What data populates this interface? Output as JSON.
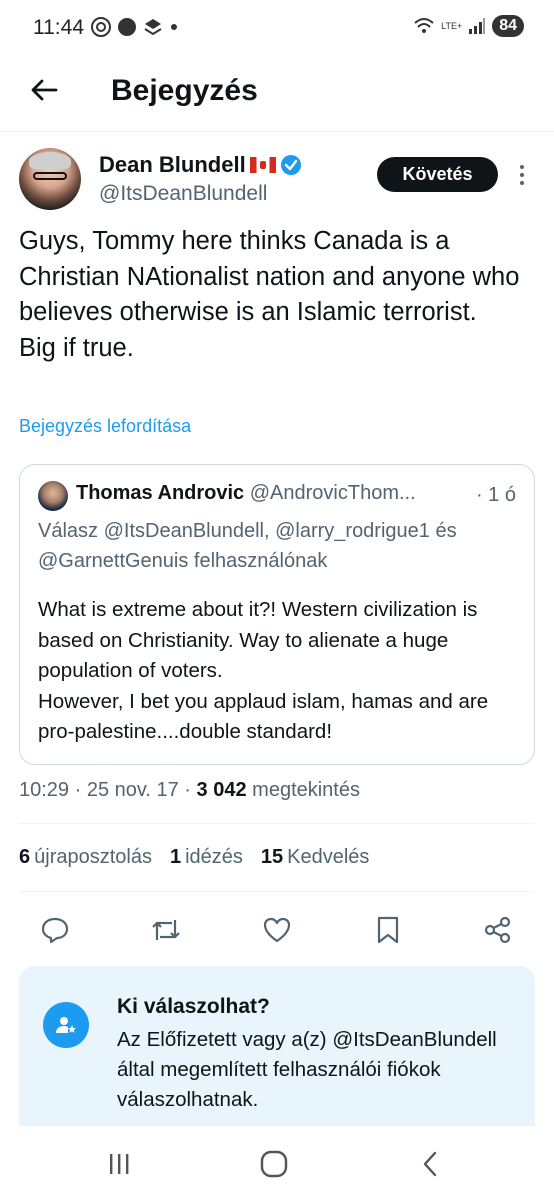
{
  "status_bar": {
    "time": "11:44",
    "network": "LTE+",
    "battery": "84"
  },
  "header": {
    "title": "Bejegyzés"
  },
  "post": {
    "author_name": "Dean Blundell",
    "author_handle": "@ItsDeanBlundell",
    "follow_label": "Követés",
    "text": "Guys, Tommy here thinks Canada is a Christian NAtionalist nation and anyone who believes otherwise is an Islamic terrorist.\nBig if true.",
    "translate_label": "Bejegyzés lefordítása"
  },
  "quote": {
    "author_name": "Thomas Androvic",
    "author_handle": "@AndrovicThom...",
    "time": "· 1 ó",
    "reply_line": "Válasz @ItsDeanBlundell, @larry_rodrigue1 és @GarnettGenuis felhasználónak",
    "text": "What is extreme about it?!  Western civilization is based on Christianity. Way to alienate a huge population of voters.\nHowever,  I bet you applaud islam, hamas and are pro-palestine....double standard!"
  },
  "meta": {
    "time": "10:29 · 25 nov. 17 · ",
    "views_count": "3 042",
    "views_label": "megtekintés"
  },
  "stats": {
    "reposts_count": "6",
    "reposts_label": "újraposztolás",
    "quotes_count": "1",
    "quotes_label": "idézés",
    "likes_count": "15",
    "likes_label": "Kedvelés"
  },
  "reply_restriction": {
    "title": "Ki válaszolhat?",
    "text": "Az Előfizetett vagy a(z) @ItsDeanBlundell által megemlített felhasználói fiókok válaszolhatnak."
  },
  "colors": {
    "accent": "#1d9bf0",
    "text": "#0f1419",
    "secondary": "#536471",
    "reply_bg": "#e8f5fd"
  }
}
